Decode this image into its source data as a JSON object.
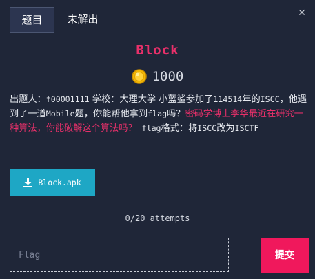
{
  "tabs": [
    {
      "label": "题目",
      "active": true
    },
    {
      "label": "未解出",
      "active": false
    }
  ],
  "close_icon": "close-icon",
  "challenge": {
    "title": "Block",
    "points": "1000",
    "description": {
      "prefix": "出题人：",
      "author": "f00001111",
      "after_author": " 学校：大理大学 小蓝鲨参加了",
      "number": "114514",
      "after_number": "年的",
      "iscc": "ISCC",
      "after_iscc": "，他遇到了一道",
      "mobile": "Mobile",
      "after_mobile": "题，你能帮他拿到",
      "flag1": "flag",
      "after_flag1": "吗？",
      "highlight": "密码学博士李华最近在研究一种算法，你能破解这个算法吗？",
      "flag2": " flag",
      "after_flag2": "格式：将",
      "iscc2": "ISCC",
      "after_iscc2": "改为",
      "isctf": "ISCTF"
    },
    "download_label": "Block.apk",
    "attempts": "0/20 attempts",
    "flag_placeholder": "Flag",
    "submit_label": "提交"
  },
  "colors": {
    "background": "#1f2638",
    "accent": "#e8306a",
    "download": "#1ea7c5",
    "submit": "#f0185c"
  }
}
